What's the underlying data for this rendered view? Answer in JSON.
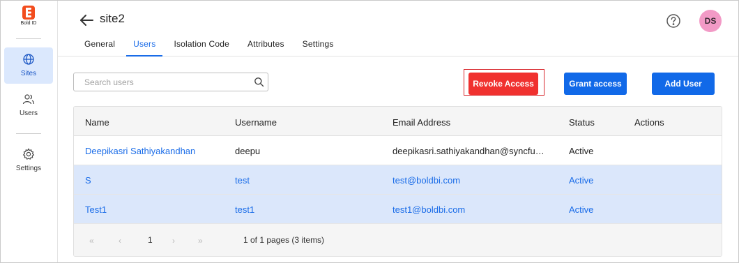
{
  "app": {
    "logo_text": "Bold ID"
  },
  "sidebar": {
    "items": [
      {
        "label": "Sites",
        "icon": "globe-icon",
        "active": true
      },
      {
        "label": "Users",
        "icon": "users-icon",
        "active": false
      },
      {
        "label": "Settings",
        "icon": "gear-icon",
        "active": false
      }
    ]
  },
  "header": {
    "title": "site2",
    "avatar_initials": "DS",
    "avatar_color": "#f29ac6",
    "tabs": [
      {
        "label": "General",
        "active": false
      },
      {
        "label": "Users",
        "active": true
      },
      {
        "label": "Isolation Code",
        "active": false
      },
      {
        "label": "Attributes",
        "active": false
      },
      {
        "label": "Settings",
        "active": false
      }
    ]
  },
  "toolbar": {
    "search_placeholder": "Search users",
    "revoke_label": "Revoke Access",
    "grant_label": "Grant access",
    "add_label": "Add User"
  },
  "table": {
    "columns": [
      "Name",
      "Username",
      "Email Address",
      "Status",
      "Actions"
    ],
    "rows": [
      {
        "name": "Deepikasri Sathiyakandhan",
        "username": "deepu",
        "email": "deepikasri.sathiyakandhan@syncfu…",
        "status": "Active",
        "selected": false
      },
      {
        "name": "S",
        "username": "test",
        "email": "test@boldbi.com",
        "status": "Active",
        "selected": true
      },
      {
        "name": "Test1",
        "username": "test1",
        "email": "test1@boldbi.com",
        "status": "Active",
        "selected": true
      }
    ]
  },
  "pager": {
    "first": "«",
    "prev": "‹",
    "page": "1",
    "next": "›",
    "last": "»",
    "info": "1 of 1 pages (3 items)"
  },
  "colors": {
    "accent": "#1169e8",
    "danger": "#f0312f",
    "selected_row": "#dbe7fb",
    "active_nav": "#dbe8fd"
  }
}
